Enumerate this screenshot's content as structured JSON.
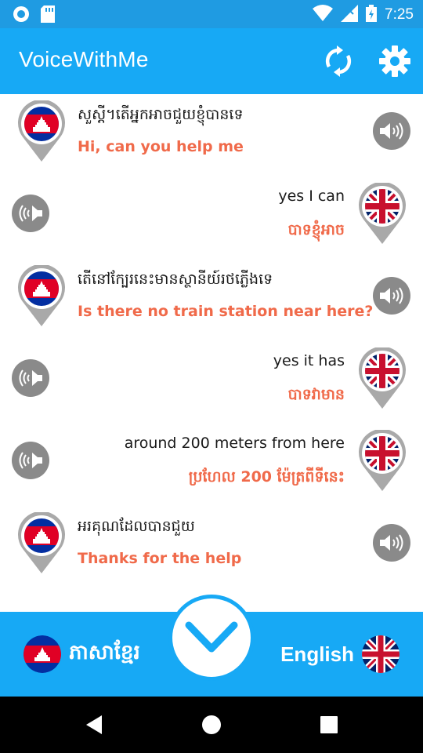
{
  "status_bar": {
    "time": "7:25",
    "icons": [
      "circle-app-icon",
      "sd-card-icon",
      "wifi-icon",
      "signal-off-icon",
      "battery-charging-icon"
    ]
  },
  "app_bar": {
    "title": "VoiceWithMe",
    "actions": [
      "refresh-icon",
      "settings-icon"
    ]
  },
  "messages": [
    {
      "side": "left",
      "flag": "khmer",
      "source": "សួស្តី។តើអ្នកអាចជួយខ្ញុំបានទេ",
      "translation": "Hi, can you help me"
    },
    {
      "side": "right",
      "flag": "english",
      "source": "yes I can",
      "translation": "បាទខ្ញុំអាច"
    },
    {
      "side": "left",
      "flag": "khmer",
      "source": "តើនៅក្បែរនេះមានស្ថានីយ៍រថភ្លើងទេ",
      "translation": "Is there no train station near here?"
    },
    {
      "side": "right",
      "flag": "english",
      "source": "yes it has",
      "translation": "បាទវាមាន"
    },
    {
      "side": "right",
      "flag": "english",
      "source": "around 200 meters from here",
      "translation": "ប្រហែល 200 ម៉ែត្រពីទីនេះ"
    },
    {
      "side": "left",
      "flag": "khmer",
      "source": "អរគុណដែលបានជួយ",
      "translation": "Thanks for the help"
    }
  ],
  "bottom_bar": {
    "left_language": "ភាសាខ្មែរ",
    "right_language": "English",
    "center_icon": "chevron-down-icon"
  },
  "colors": {
    "primary": "#17a9f5",
    "status_bar": "#1f9be2",
    "translation_text": "#f06a4a",
    "speaker_bg": "#8a8a8a"
  },
  "nav_bar": {
    "buttons": [
      "back-icon",
      "home-icon",
      "recents-icon"
    ]
  }
}
